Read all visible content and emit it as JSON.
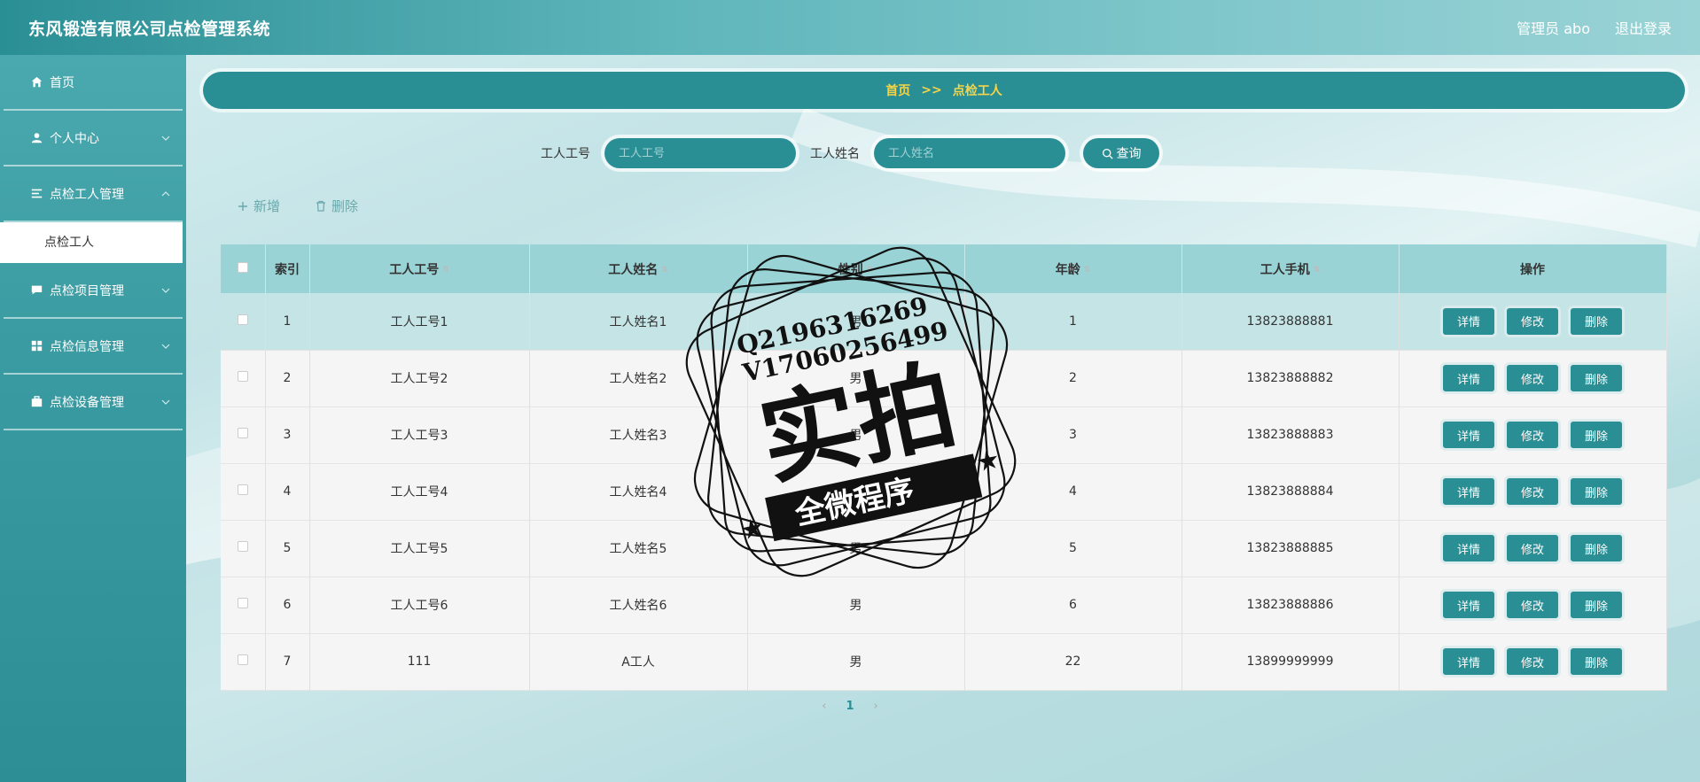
{
  "header": {
    "title": "东风锻造有限公司点检管理系统",
    "user": "管理员 abo",
    "logout": "退出登录"
  },
  "sidebar": {
    "items": [
      {
        "label": "首页",
        "icon": "home-icon"
      },
      {
        "label": "个人中心",
        "icon": "user-icon"
      },
      {
        "label": "点检工人管理",
        "icon": "list-icon"
      },
      {
        "label": "点检工人",
        "icon": ""
      },
      {
        "label": "点检项目管理",
        "icon": "message-icon"
      },
      {
        "label": "点检信息管理",
        "icon": "grid-icon"
      },
      {
        "label": "点检设备管理",
        "icon": "briefcase-icon"
      }
    ]
  },
  "breadcrumb": {
    "home": "首页",
    "sep": ">>",
    "current": "点检工人"
  },
  "search": {
    "worker_no_label": "工人工号",
    "worker_no_placeholder": "工人工号",
    "worker_name_label": "工人姓名",
    "worker_name_placeholder": "工人姓名",
    "button": "查询"
  },
  "actions": {
    "add": "新增",
    "delete": "删除"
  },
  "table": {
    "columns": [
      "索引",
      "工人工号",
      "工人姓名",
      "性别",
      "年龄",
      "工人手机",
      "操作"
    ],
    "rows": [
      {
        "index": "1",
        "no": "工人工号1",
        "name": "工人姓名1",
        "gender": "男",
        "age": "1",
        "phone": "13823888881"
      },
      {
        "index": "2",
        "no": "工人工号2",
        "name": "工人姓名2",
        "gender": "男",
        "age": "2",
        "phone": "13823888882"
      },
      {
        "index": "3",
        "no": "工人工号3",
        "name": "工人姓名3",
        "gender": "男",
        "age": "3",
        "phone": "13823888883"
      },
      {
        "index": "4",
        "no": "工人工号4",
        "name": "工人姓名4",
        "gender": "男",
        "age": "4",
        "phone": "13823888884"
      },
      {
        "index": "5",
        "no": "工人工号5",
        "name": "工人姓名5",
        "gender": "男",
        "age": "5",
        "phone": "13823888885"
      },
      {
        "index": "6",
        "no": "工人工号6",
        "name": "工人姓名6",
        "gender": "男",
        "age": "6",
        "phone": "13823888886"
      },
      {
        "index": "7",
        "no": "111",
        "name": "A工人",
        "gender": "男",
        "age": "22",
        "phone": "13899999999"
      }
    ],
    "op_detail": "详情",
    "op_edit": "修改",
    "op_delete": "删除"
  },
  "pager": {
    "current": "1"
  },
  "watermark": {
    "line1": "Q2196316269",
    "line2": "V17060256499",
    "main": "实拍",
    "banner": "全微程序"
  },
  "colors": {
    "primary": "#2a8f95",
    "header_light": "#9ad3d6",
    "breadcrumb_text": "#f5d547"
  }
}
